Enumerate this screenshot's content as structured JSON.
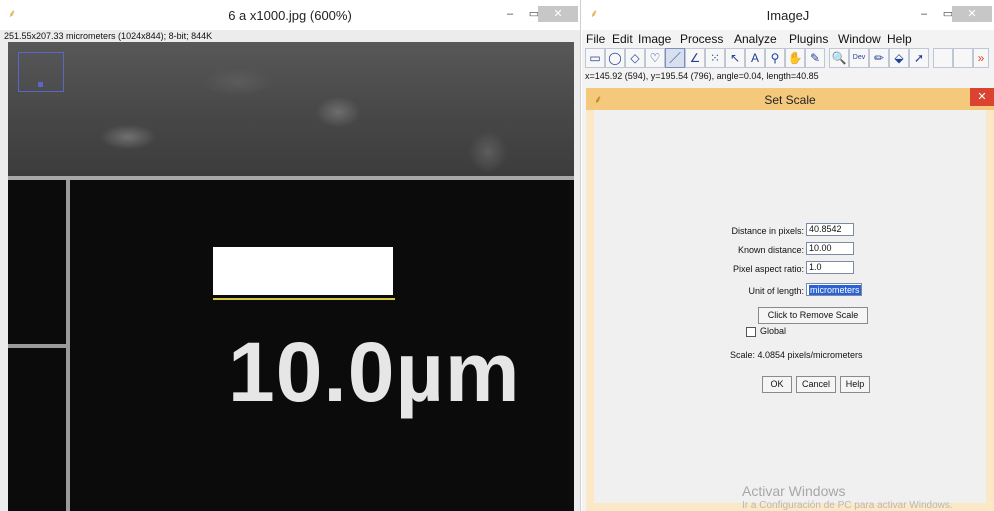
{
  "image_window": {
    "title": "6 a x1000.jpg (600%)",
    "info": "251.55x207.33 micrometers (1024x844); 8-bit; 844K",
    "scale_label": "10.0µm"
  },
  "imagej": {
    "title": "ImageJ",
    "menu": [
      "File",
      "Edit",
      "Image",
      "Process",
      "Analyze",
      "Plugins",
      "Window",
      "Help"
    ],
    "status": "x=145.92 (594), y=195.54 (796), angle=0.04, length=40.85",
    "tools": [
      "rectangle",
      "oval",
      "polygon",
      "freehand",
      "straight-line",
      "angle",
      "multi-point",
      "wand",
      "text",
      "magnifier",
      "hand",
      "color-picker",
      "zoom",
      "dev",
      "pencil",
      "fill",
      "arrow"
    ]
  },
  "set_scale": {
    "title": "Set Scale",
    "distance_label": "Distance in pixels:",
    "distance_value": "40.8542",
    "known_label": "Known distance:",
    "known_value": "10.00",
    "aspect_label": "Pixel aspect ratio:",
    "aspect_value": "1.0",
    "unit_label": "Unit of length:",
    "unit_value": "micrometers",
    "remove_button": "Click to Remove Scale",
    "global_label": "Global",
    "scale_text": "Scale: 4.0854 pixels/micrometers",
    "ok": "OK",
    "cancel": "Cancel",
    "help": "Help"
  },
  "watermark": {
    "line1": "Activar Windows",
    "line2": "Ir a Configuración de PC para activar Windows."
  },
  "colors": {
    "dialog_title": "#f4c97c",
    "selection": "#2a62d4",
    "scale_bar_line": "#d8c740"
  }
}
